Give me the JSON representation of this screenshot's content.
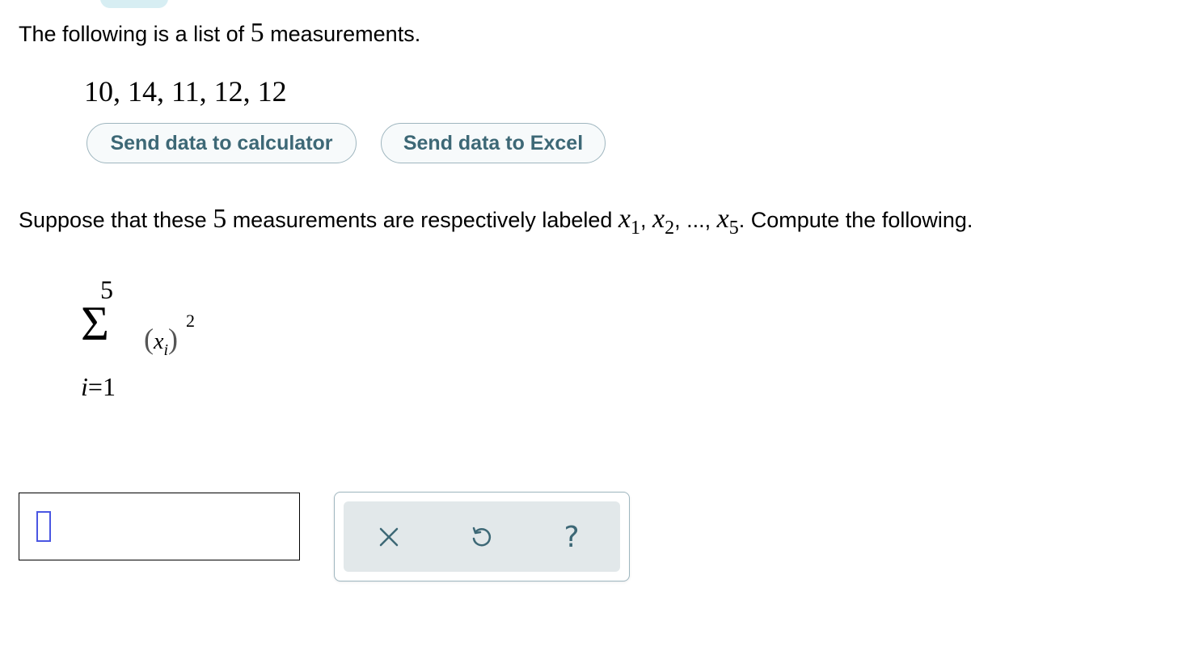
{
  "intro": {
    "text_before": "The following is a list of ",
    "count": "5",
    "text_after": " measurements."
  },
  "data_list": "10, 14, 11, 12, 12",
  "buttons": {
    "calculator": "Send data to calculator",
    "excel": "Send data to Excel"
  },
  "prompt": {
    "text_before": "Suppose that these ",
    "count": "5",
    "text_middle": " measurements are respectively labeled ",
    "var": "x",
    "sub1": "1",
    "sep1": ", ",
    "sub2": "2",
    "sep2": ", ..., ",
    "sub3": "5",
    "text_after": ". Compute the following."
  },
  "formula": {
    "upper": "5",
    "sigma": "Σ",
    "var": "x",
    "index": "i",
    "exponent": "2",
    "lower_var": "i",
    "lower_eq": "=",
    "lower_val": "1"
  },
  "answer": {
    "value": ""
  },
  "toolbar": {
    "clear_icon": "close-icon",
    "undo_icon": "undo-icon",
    "help_label": "?"
  },
  "colors": {
    "accent": "#3d6876",
    "button_border": "#9fb6bf",
    "toolbar_bg": "#e2e8ea",
    "cursor": "#4a56e2",
    "tab": "#d7eef3"
  }
}
